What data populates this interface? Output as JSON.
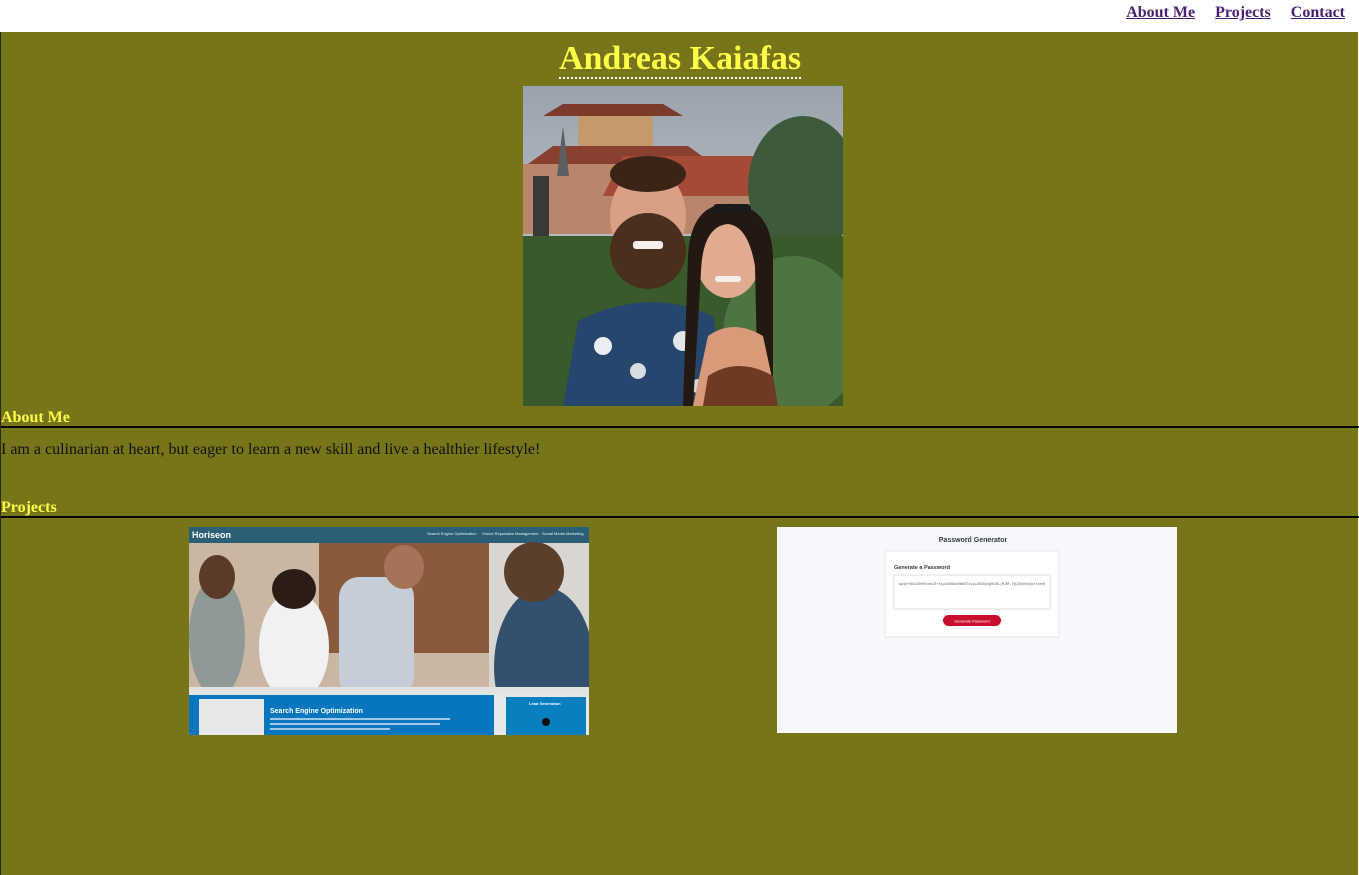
{
  "nav": {
    "links": [
      {
        "label": "About Me"
      },
      {
        "label": "Projects"
      },
      {
        "label": "Contact"
      }
    ]
  },
  "header": {
    "title": "Andreas Kaiafas"
  },
  "about": {
    "heading": "About Me",
    "text": "I am a culinarian at heart, but eager to learn a new skill and live a healthier lifestyle!"
  },
  "projects": {
    "heading": "Projects",
    "items": [
      {
        "brand": "Horiseon",
        "nav": [
          "Search Engine Optimization",
          "Online Reputation Management",
          "Social Media Marketing"
        ],
        "section_title": "Search Engine Optimization",
        "sidebar_title": "Lead Generation"
      },
      {
        "title": "Password Generator",
        "card_title": "Generate a Password",
        "password": "Ap4y+h8UJXDOOrvoEJErTauCk5bO9rHbD8T1v411Eb9azgDHJBl)MJRF,EQJjDdSnzpsr5tesR",
        "button_label": "Generate Password"
      }
    ]
  },
  "colors": {
    "background": "#767519",
    "title": "#ffff4a",
    "link": "#4b1f6f"
  }
}
